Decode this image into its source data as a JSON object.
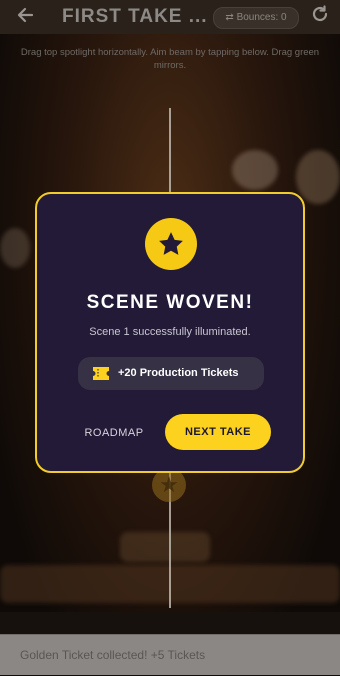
{
  "header": {
    "back_icon": "arrow-left-icon",
    "title": "FIRST TAKE ...",
    "bounces_label": "Bounces: 0",
    "bounces_icon": "bounce-icon",
    "refresh_icon": "refresh-icon"
  },
  "instructions": "Drag top spotlight horizontally. Aim beam by tapping below. Drag green mirrors.",
  "modal": {
    "icon": "star-icon",
    "title": "SCENE WOVEN!",
    "subtitle": "Scene 1 successfully illuminated.",
    "reward_icon": "ticket-icon",
    "reward_text": "+20 Production Tickets",
    "roadmap_label": "ROADMAP",
    "next_label": "NEXT TAKE"
  },
  "toast": "Golden Ticket collected! +5 Tickets",
  "colors": {
    "accent": "#fcd21f",
    "modal_bg": "#221a36",
    "modal_border": "#f2cc2a"
  }
}
